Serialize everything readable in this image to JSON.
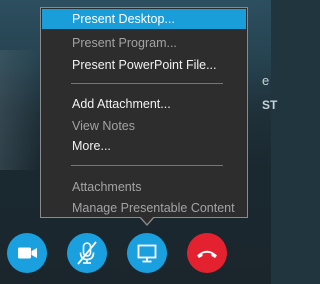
{
  "menu": {
    "items": [
      {
        "label": "Present Desktop...",
        "state": "selected"
      },
      {
        "label": "Present Program...",
        "state": "disabled"
      },
      {
        "label": "Present PowerPoint File...",
        "state": "enabled"
      },
      {
        "label": "Add Attachment...",
        "state": "enabled"
      },
      {
        "label": "View Notes",
        "state": "disabled"
      },
      {
        "label": "More...",
        "state": "enabled"
      },
      {
        "label": "Attachments",
        "state": "disabled"
      },
      {
        "label": "Manage Presentable Content",
        "state": "disabled"
      }
    ]
  },
  "background": {
    "peek_1": "e",
    "peek_2": "ST"
  },
  "controls": {
    "video": {
      "icon": "video-camera-icon",
      "color": "#1aa0de"
    },
    "mic": {
      "icon": "microphone-muted-icon",
      "color": "#1aa0de"
    },
    "present": {
      "icon": "monitor-icon",
      "color": "#1aa0de"
    },
    "hangup": {
      "icon": "phone-hangup-icon",
      "color": "#e4222f"
    }
  },
  "colors": {
    "menu_bg": "#2d2d2d",
    "selected_bg": "#1a9ed9",
    "disabled_text": "#a3a3a3"
  }
}
